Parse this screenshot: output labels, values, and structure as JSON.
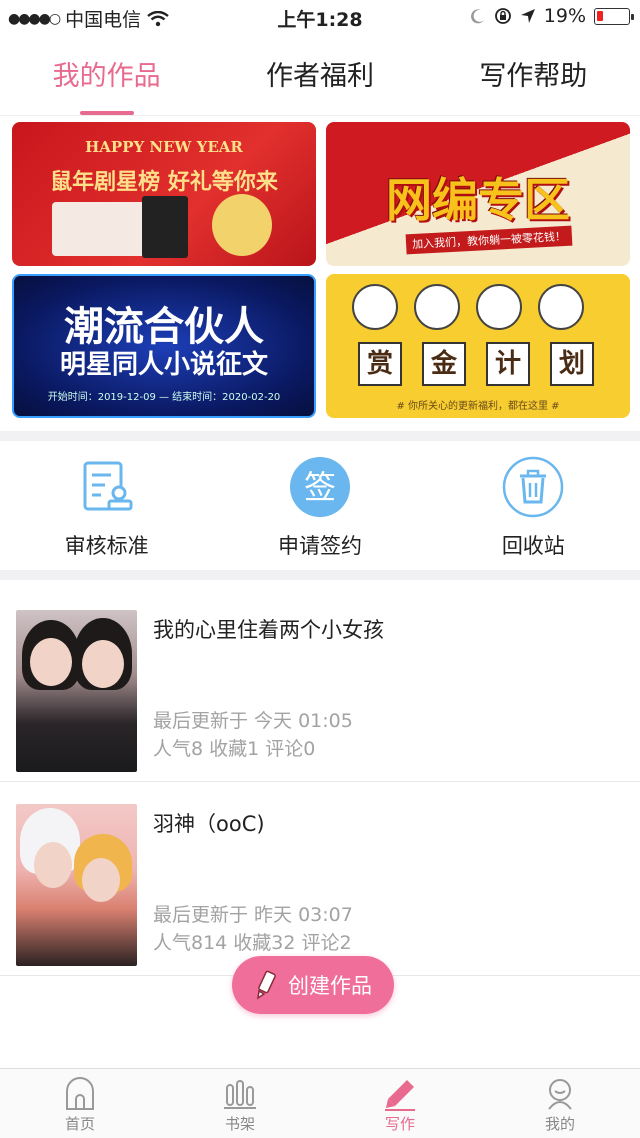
{
  "status_bar": {
    "carrier": "中国电信",
    "time": "上午1:28",
    "battery": "19%",
    "battery_level": 0.19
  },
  "tabs": [
    {
      "label": "我的作品",
      "active": true
    },
    {
      "label": "作者福利",
      "active": false
    },
    {
      "label": "写作帮助",
      "active": false
    }
  ],
  "banners": {
    "b1": {
      "line1": "HAPPY NEW YEAR",
      "line2": "鼠年剧星榜 好礼等你来"
    },
    "b2": {
      "title": "网编专区",
      "subtitle": "加入我们，教你躺一被零花钱！"
    },
    "b3": {
      "line1": "潮流合伙人",
      "line2": "明星同人小说征文",
      "line3": "开始时间：2019-12-09 — 结束时间：2020-02-20"
    },
    "b4": {
      "chars": [
        "赏",
        "金",
        "计",
        "划"
      ],
      "footer": "# 你所关心的更新福利，都在这里 #"
    }
  },
  "actions": [
    {
      "label": "审核标准",
      "icon": "review-standard-icon"
    },
    {
      "label": "申请签约",
      "icon_text": "签",
      "icon": "sign-contract-icon"
    },
    {
      "label": "回收站",
      "icon": "trash-icon"
    }
  ],
  "works": [
    {
      "title": "我的心里住着两个小女孩",
      "updated": "最后更新于 今天 01:05",
      "stats": "人气8 收藏1 评论0"
    },
    {
      "title": "羽神（ooC)",
      "updated": "最后更新于 昨天 03:07",
      "stats": "人气814 收藏32 评论2"
    }
  ],
  "create_button": {
    "label": "创建作品"
  },
  "nav": [
    {
      "label": "首页",
      "icon": "home-icon",
      "active": false
    },
    {
      "label": "书架",
      "icon": "bookshelf-icon",
      "active": false
    },
    {
      "label": "写作",
      "icon": "pen-icon",
      "active": true
    },
    {
      "label": "我的",
      "icon": "profile-icon",
      "active": false
    }
  ],
  "colors": {
    "accent": "#e86a8e",
    "button": "#f06e9a",
    "icon_blue": "#69b7ee"
  }
}
